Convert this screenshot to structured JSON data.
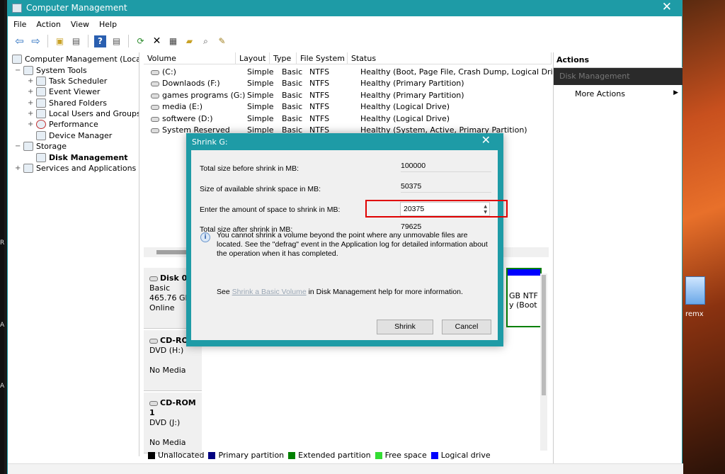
{
  "window": {
    "title": "Computer Management",
    "close_glyph": "✕",
    "accent": "#1e9ba6"
  },
  "menu": [
    "File",
    "Action",
    "View",
    "Help"
  ],
  "toolbar_icons": [
    "back-arrow-icon",
    "forward-arrow-icon",
    "up-folder-icon",
    "show-hide-tree-icon",
    "help-icon",
    "properties-icon",
    "refresh-icon",
    "delete-icon",
    "disk-properties-icon",
    "open-icon",
    "search-icon",
    "edit-icon"
  ],
  "tree": [
    {
      "label": "Computer Management (Local",
      "level": 0,
      "expander": ""
    },
    {
      "label": "System Tools",
      "level": 1,
      "expander": "−"
    },
    {
      "label": "Task Scheduler",
      "level": 2,
      "expander": "+"
    },
    {
      "label": "Event Viewer",
      "level": 2,
      "expander": "+"
    },
    {
      "label": "Shared Folders",
      "level": 2,
      "expander": "+"
    },
    {
      "label": "Local Users and Groups",
      "level": 2,
      "expander": "+"
    },
    {
      "label": "Performance",
      "level": 2,
      "expander": "+"
    },
    {
      "label": "Device Manager",
      "level": 2,
      "expander": ""
    },
    {
      "label": "Storage",
      "level": 1,
      "expander": "−"
    },
    {
      "label": "Disk Management",
      "level": 2,
      "expander": "",
      "bold": true
    },
    {
      "label": "Services and Applications",
      "level": 1,
      "expander": "+"
    }
  ],
  "volumes": {
    "headers": [
      "Volume",
      "Layout",
      "Type",
      "File System",
      "Status"
    ],
    "rows": [
      [
        "(C:)",
        "Simple",
        "Basic",
        "NTFS",
        "Healthy (Boot, Page File, Crash Dump, Logical Drive)"
      ],
      [
        "Downlaods (F:)",
        "Simple",
        "Basic",
        "NTFS",
        "Healthy (Primary Partition)"
      ],
      [
        "games programs (G:)",
        "Simple",
        "Basic",
        "NTFS",
        "Healthy (Primary Partition)"
      ],
      [
        "media (E:)",
        "Simple",
        "Basic",
        "NTFS",
        "Healthy (Logical Drive)"
      ],
      [
        "softwere (D:)",
        "Simple",
        "Basic",
        "NTFS",
        "Healthy (Logical Drive)"
      ],
      [
        "System Reserved",
        "Simple",
        "Basic",
        "NTFS",
        "Healthy (System, Active, Primary Partition)"
      ]
    ]
  },
  "actions": {
    "header": "Actions",
    "selected": "Disk Management",
    "more": "More Actions"
  },
  "disks": [
    {
      "name": "Disk 0",
      "lines": [
        "Basic",
        "465.76 GB",
        "Online"
      ],
      "partition_text_1": "GB NTF",
      "partition_text_2": "y (Boot"
    },
    {
      "name": "CD-ROM 0",
      "name_visible": "CD-ROM",
      "lines": [
        "DVD (H:)",
        "",
        "No Media"
      ]
    },
    {
      "name": "CD-ROM 1",
      "lines": [
        "DVD (J:)",
        "",
        "No Media"
      ]
    }
  ],
  "legend": [
    {
      "label": "Unallocated",
      "color": "#000000"
    },
    {
      "label": "Primary partition",
      "color": "#000080"
    },
    {
      "label": "Extended partition",
      "color": "#008000"
    },
    {
      "label": "Free space",
      "color": "#33dd33"
    },
    {
      "label": "Logical drive",
      "color": "#0000ff"
    }
  ],
  "dialog": {
    "title": "Shrink G:",
    "close_glyph": "✕",
    "rows": [
      {
        "label": "Total size before shrink in MB:",
        "value": "100000"
      },
      {
        "label": "Size of available shrink space in MB:",
        "value": "50375"
      },
      {
        "label": "Enter the amount of space to shrink in MB:",
        "value": "20375"
      },
      {
        "label": "Total size after shrink in MB:",
        "value": "79625"
      }
    ],
    "info": "You cannot shrink a volume beyond the point where any unmovable files are located. See the \"defrag\" event in the Application log for detailed information about the operation when it has completed.",
    "help_prefix": "See",
    "help_link": "Shrink a Basic Volume",
    "help_suffix": "in Disk Management help for more information.",
    "shrink_label": "Shrink",
    "cancel_label": "Cancel"
  },
  "desktop": {
    "icon_label": "remx",
    "edge_letters": [
      "R",
      "A",
      "A"
    ]
  }
}
